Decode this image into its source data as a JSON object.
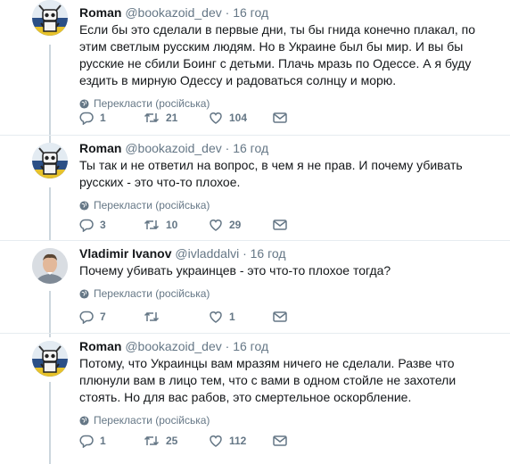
{
  "tweets": [
    {
      "name": "Roman",
      "handle": "@bookazoid_dev",
      "dot": "·",
      "time": "16 год",
      "text": "Если бы это сделали в первые дни, ты бы гнида конечно плакал, по этим светлым русским людям. Но в Украине был бы мир. И вы бы русские не сбили Боинг с детьми. Плачь мразь по Одессе. А я буду ездить в мирную Одессу и радоваться солнцу и морю.",
      "translate": "Перекласти (російська)",
      "replies": "1",
      "retweets": "21",
      "likes": "104",
      "avatar": "robot"
    },
    {
      "name": "Roman",
      "handle": "@bookazoid_dev",
      "dot": "·",
      "time": "16 год",
      "text": "Ты так и не ответил на вопрос, в чем я не прав. И почему убивать русских - это что-то плохое.",
      "translate": "Перекласти (російська)",
      "replies": "3",
      "retweets": "10",
      "likes": "29",
      "avatar": "robot"
    },
    {
      "name": "Vladimir Ivanov",
      "handle": "@ivladdalvi",
      "dot": "·",
      "time": "16 год",
      "text": "Почему убивать украинцев - это что-то плохое тогда?",
      "translate": "Перекласти (російська)",
      "replies": "7",
      "retweets": "",
      "likes": "1",
      "avatar": "person"
    },
    {
      "name": "Roman",
      "handle": "@bookazoid_dev",
      "dot": "·",
      "time": "16 год",
      "text": "Потому, что Украинцы вам мразям ничего не сделали. Разве что плюнули вам в лицо тем, что с вами в одном стойле не захотели стоять. Но для вас рабов, это смертельное оскорбление.",
      "translate": "Перекласти (російська)",
      "replies": "1",
      "retweets": "25",
      "likes": "112",
      "avatar": "robot"
    }
  ],
  "colors": {
    "text": "#14171a",
    "secondary": "#657786",
    "border": "#e6ecf0",
    "thread": "#ccd6dd"
  }
}
